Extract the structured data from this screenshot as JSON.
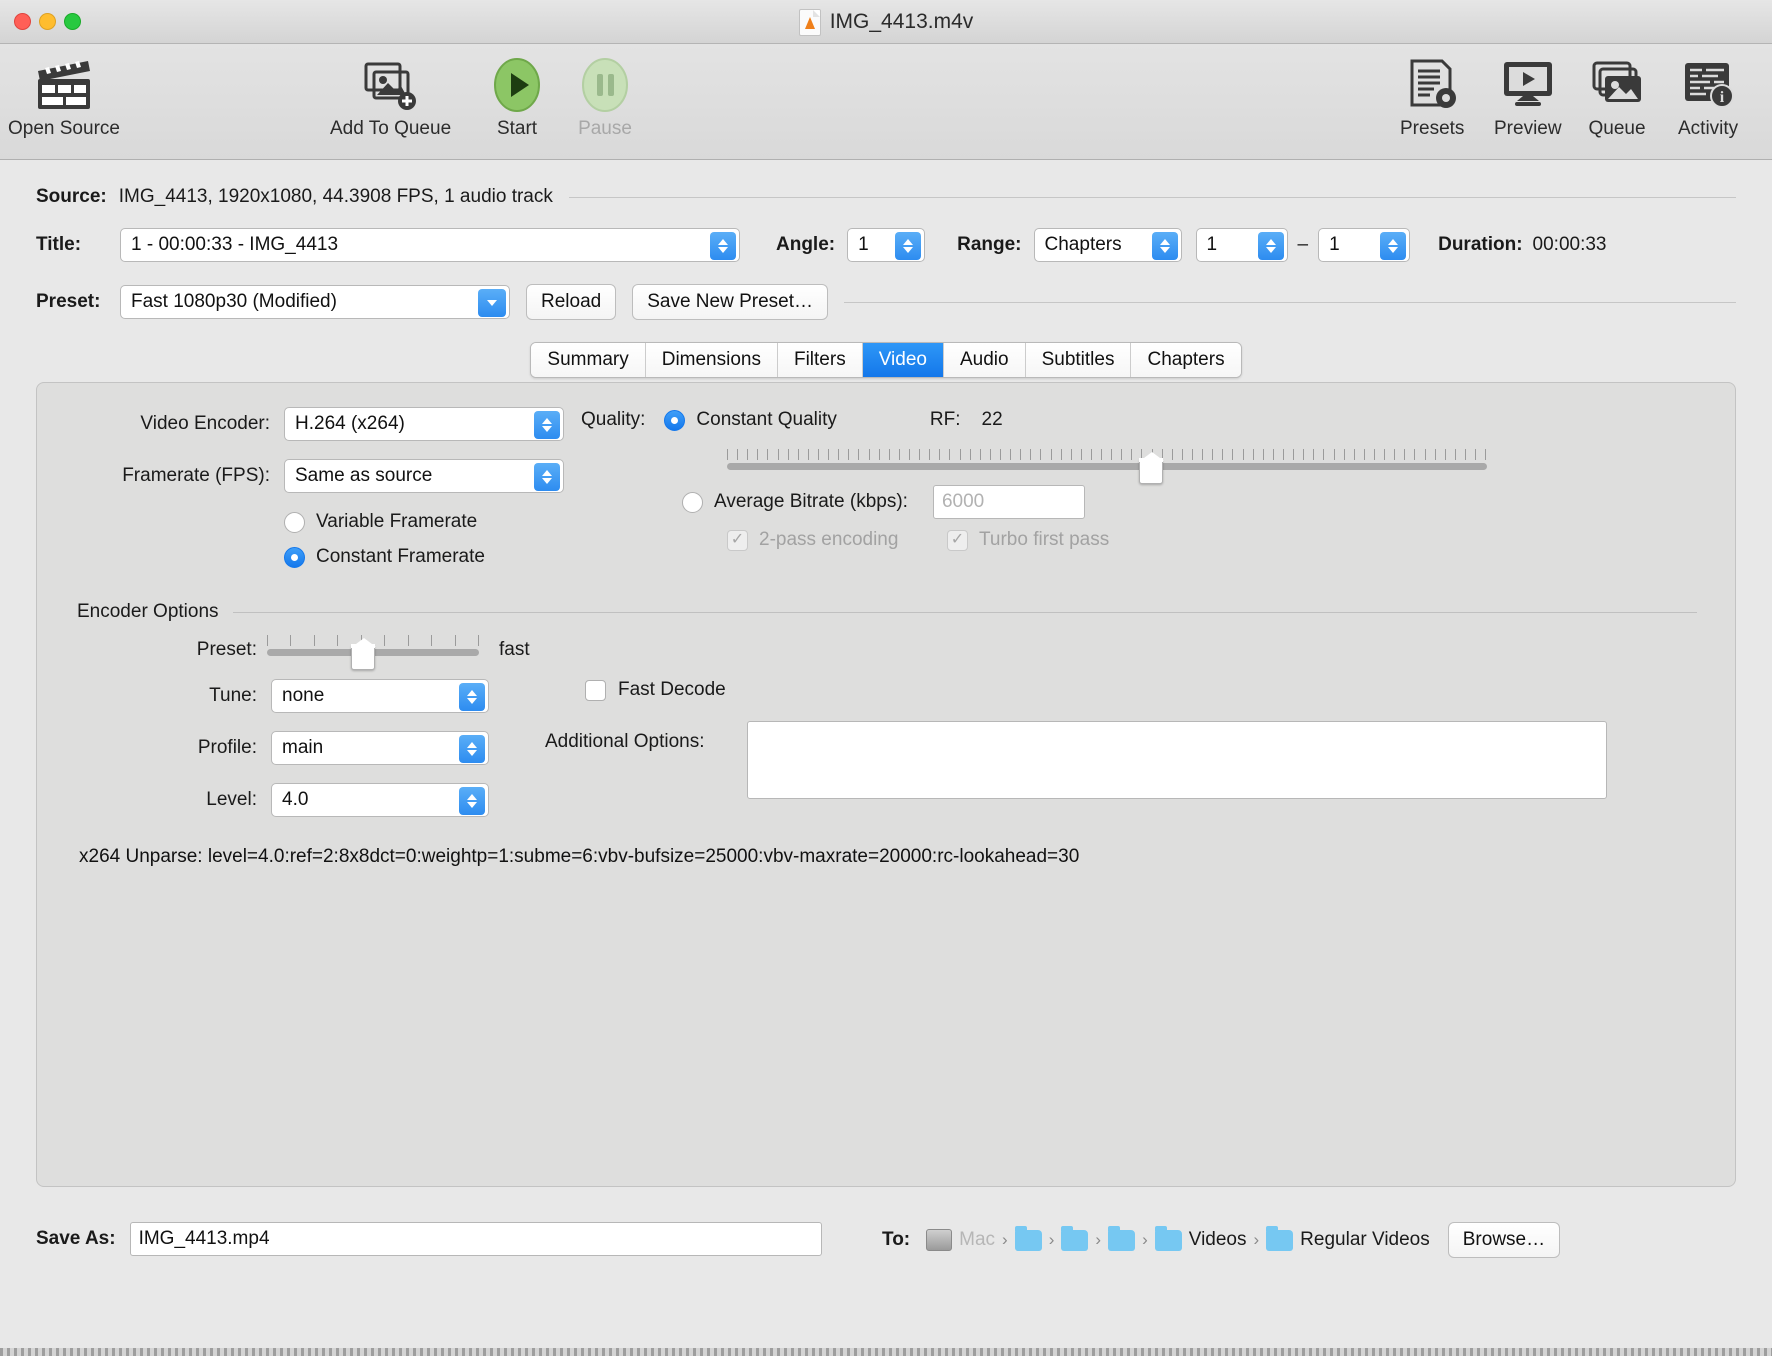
{
  "window": {
    "title": "IMG_4413.m4v",
    "file_icon": "vlc-file-icon"
  },
  "toolbar": {
    "items": [
      {
        "label": "Open Source",
        "icon": "clapperboard-icon",
        "enabled": true
      },
      {
        "label": "Add To Queue",
        "icon": "add-image-icon",
        "enabled": true
      },
      {
        "label": "Start",
        "icon": "play-icon",
        "enabled": true
      },
      {
        "label": "Pause",
        "icon": "pause-icon",
        "enabled": false
      },
      {
        "label": "Presets",
        "icon": "presets-icon",
        "enabled": true
      },
      {
        "label": "Preview",
        "icon": "preview-icon",
        "enabled": true
      },
      {
        "label": "Queue",
        "icon": "queue-icon",
        "enabled": true
      },
      {
        "label": "Activity",
        "icon": "activity-icon",
        "enabled": true
      }
    ]
  },
  "source": {
    "label": "Source:",
    "value": "IMG_4413, 1920x1080, 44.3908 FPS, 1 audio track"
  },
  "title_row": {
    "title_label": "Title:",
    "title_value": "1 - 00:00:33 - IMG_4413",
    "angle_label": "Angle:",
    "angle_value": "1",
    "range_label": "Range:",
    "range_type": "Chapters",
    "range_start": "1",
    "range_dash": "–",
    "range_end": "1",
    "duration_label": "Duration:",
    "duration_value": "00:00:33"
  },
  "preset_row": {
    "label": "Preset:",
    "value": "Fast 1080p30 (Modified)",
    "reload_label": "Reload",
    "save_label": "Save New Preset…"
  },
  "tabs": [
    {
      "label": "Summary",
      "active": false
    },
    {
      "label": "Dimensions",
      "active": false
    },
    {
      "label": "Filters",
      "active": false
    },
    {
      "label": "Video",
      "active": true
    },
    {
      "label": "Audio",
      "active": false
    },
    {
      "label": "Subtitles",
      "active": false
    },
    {
      "label": "Chapters",
      "active": false
    }
  ],
  "video": {
    "encoder_label": "Video Encoder:",
    "encoder_value": "H.264 (x264)",
    "framerate_label": "Framerate (FPS):",
    "framerate_value": "Same as source",
    "variable_framerate_label": "Variable Framerate",
    "variable_framerate_selected": false,
    "constant_framerate_label": "Constant Framerate",
    "constant_framerate_selected": true,
    "quality_label": "Quality:",
    "constant_quality_label": "Constant Quality",
    "constant_quality_selected": true,
    "rf_label": "RF:",
    "rf_value": "22",
    "rf_slider_percent": 56,
    "avg_bitrate_label": "Average Bitrate (kbps):",
    "avg_bitrate_selected": false,
    "avg_bitrate_placeholder": "6000",
    "two_pass_label": "2-pass encoding",
    "two_pass_checked": true,
    "two_pass_enabled": false,
    "turbo_label": "Turbo first pass",
    "turbo_checked": true,
    "turbo_enabled": false
  },
  "encoder_options": {
    "group_label": "Encoder Options",
    "preset_label": "Preset:",
    "preset_slider_value": "fast",
    "preset_slider_index": 4,
    "preset_slider_ticks": 10,
    "tune_label": "Tune:",
    "tune_value": "none",
    "profile_label": "Profile:",
    "profile_value": "main",
    "level_label": "Level:",
    "level_value": "4.0",
    "fast_decode_label": "Fast Decode",
    "fast_decode_checked": false,
    "additional_options_label": "Additional Options:",
    "additional_options_value": "",
    "unparse": "x264 Unparse: level=4.0:ref=2:8x8dct=0:weightp=1:subme=6:vbv-bufsize=25000:vbv-maxrate=20000:rc-lookahead=30"
  },
  "save": {
    "save_as_label": "Save As:",
    "save_as_value": "IMG_4413.mp4",
    "to_label": "To:",
    "breadcrumb": [
      {
        "name": "Mac",
        "icon": "hard-drive-icon",
        "truncated": true
      },
      {
        "name": "",
        "icon": "folder-icon"
      },
      {
        "name": "",
        "icon": "folder-icon"
      },
      {
        "name": "",
        "icon": "folder-icon"
      },
      {
        "name": "Videos",
        "icon": "folder-icon"
      },
      {
        "name": "Regular Videos",
        "icon": "folder-icon"
      }
    ],
    "browse_label": "Browse…"
  },
  "colors": {
    "accent": "#1478ec",
    "window_bg": "#e8e8e8",
    "panel_bg": "#dededd",
    "tab_active": "#1e86f0"
  }
}
